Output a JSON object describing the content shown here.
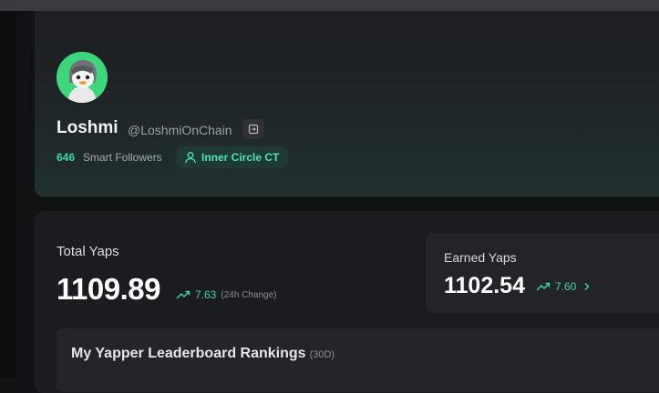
{
  "profile": {
    "name": "Loshmi",
    "handle": "@LoshmiOnChain",
    "smart_followers_count": "646",
    "smart_followers_label": "Smart Followers",
    "badge_label": "Inner Circle CT"
  },
  "yaps": {
    "total_label": "Total Yaps",
    "total_value": "1109.89",
    "total_change": "7.63",
    "total_change_note": "(24h Change)",
    "earned_label": "Earned Yaps",
    "earned_value": "1102.54",
    "earned_change": "7.60"
  },
  "leaderboard": {
    "title": "My Yapper Leaderboard Rankings",
    "period": "(30D)"
  },
  "colors": {
    "accent": "#3fd6a6",
    "avatar_bg": "#3dd67b",
    "background": "#111214"
  }
}
